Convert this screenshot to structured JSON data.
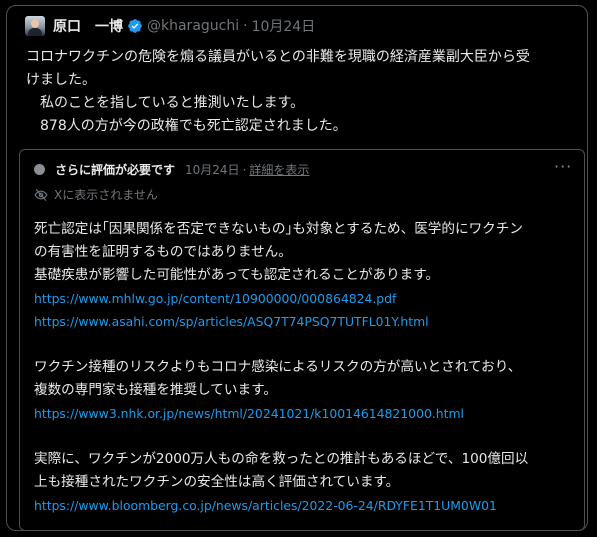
{
  "tweet": {
    "display_name": "原口　一博",
    "handle": "@kharaguchi",
    "dot": "·",
    "date": "10月24日",
    "colors": {
      "verified": "#1d9bf0",
      "text": "#e7e9ea",
      "muted": "#71767b",
      "link": "#1d9bf0"
    },
    "lines": [
      "コロナワクチンの危険を煽る議員がいるとの非難を現職の経済産業副大臣から受",
      "けました。",
      "　私のことを指していると推測いたします。",
      "　878人の方が今の政権でも死亡認定されました。"
    ]
  },
  "note": {
    "status_title": "さらに評価が必要です",
    "date": "10月24日",
    "sep": "·",
    "detail_link": "詳細を表示",
    "more_icon_glyph": "···",
    "not_shown": "Xに表示されません",
    "body_lines_1": [
      "死亡認定は｢因果関係を否定できないもの｣も対象とするため、医学的にワクチン",
      "の有害性を証明するものではありません。",
      "基礎疾患が影響した可能性があっても認定されることがあります。"
    ],
    "links_1": [
      "https://www.mhlw.go.jp/content/10900000/000864824.pdf",
      "https://www.asahi.com/sp/articles/ASQ7T74PSQ7TUTFL01Y.html"
    ],
    "body_lines_2": [
      "ワクチン接種のリスクよりもコロナ感染によるリスクの方が高いとされており、",
      "複数の専門家も接種を推奨しています。"
    ],
    "links_2": [
      "https://www3.nhk.or.jp/news/html/20241021/k10014614821000.html"
    ],
    "body_lines_3": [
      "実際に、ワクチンが2000万人もの命を救ったとの推計もあるほどで、100億回以",
      "上も接種されたワクチンの安全性は高く評価されています。"
    ],
    "links_3": [
      "https://www.bloomberg.co.jp/news/articles/2022-06-24/RDYFE1T1UM0W01"
    ]
  }
}
